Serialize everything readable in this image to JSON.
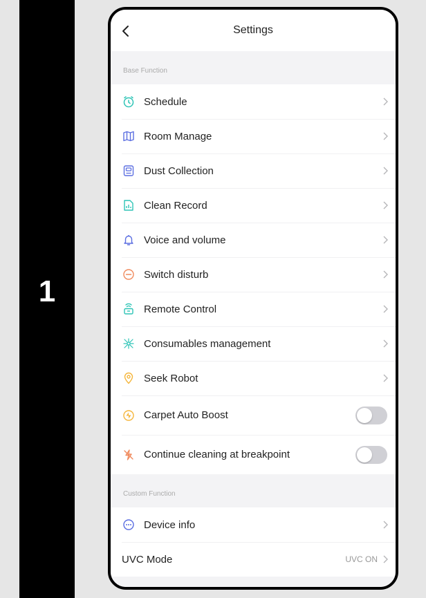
{
  "step": "1",
  "header": {
    "title": "Settings"
  },
  "sections": {
    "base": "Base Function",
    "custom": "Custom Function"
  },
  "base_items": [
    {
      "label": "Schedule",
      "icon": "clock-icon",
      "color": "#2ec4b6"
    },
    {
      "label": "Room Manage",
      "icon": "map-icon",
      "color": "#5b6ee1"
    },
    {
      "label": "Dust Collection",
      "icon": "dust-bin-icon",
      "color": "#5b6ee1"
    },
    {
      "label": "Clean Record",
      "icon": "record-icon",
      "color": "#2ec4b6"
    },
    {
      "label": "Voice and volume",
      "icon": "bell-icon",
      "color": "#5b6ee1"
    },
    {
      "label": "Switch disturb",
      "icon": "minus-circle-icon",
      "color": "#f08a5d"
    },
    {
      "label": "Remote Control",
      "icon": "remote-icon",
      "color": "#2ec4b6"
    },
    {
      "label": "Consumables management",
      "icon": "consumables-icon",
      "color": "#2ec4b6"
    },
    {
      "label": "Seek Robot",
      "icon": "location-pin-icon",
      "color": "#f5b63c"
    }
  ],
  "toggle_items": [
    {
      "label": "Carpet Auto Boost",
      "icon": "boost-icon",
      "color": "#f5b63c",
      "on": false
    },
    {
      "label": "Continue cleaning at breakpoint",
      "icon": "breakpoint-icon",
      "color": "#f08a5d",
      "on": false
    }
  ],
  "custom_items": [
    {
      "label": "Device info",
      "icon": "info-dots-icon",
      "color": "#5b6ee1"
    }
  ],
  "uvc": {
    "label": "UVC Mode",
    "value": "UVC ON"
  }
}
